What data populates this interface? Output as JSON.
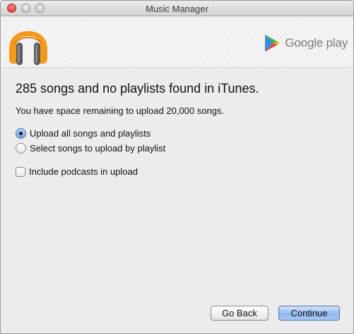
{
  "window": {
    "title": "Music Manager"
  },
  "header": {
    "brand_text": "Google play"
  },
  "content": {
    "heading": "285 songs and no playlists found in iTunes.",
    "subtext": "You have space remaining to upload 20,000 songs.",
    "options": [
      {
        "label": "Upload all songs and playlists",
        "selected": true
      },
      {
        "label": "Select songs to upload by playlist",
        "selected": false
      }
    ],
    "podcasts": {
      "label": "Include podcasts in upload",
      "checked": false
    }
  },
  "buttons": {
    "back": "Go Back",
    "continue": "Continue"
  },
  "colors": {
    "accent": "#6fa1e4",
    "headphone_orange": "#f39a1b",
    "play_green": "#3bb54a",
    "play_blue": "#3c8fd6",
    "play_red": "#e9443a",
    "play_yellow": "#f6c21b"
  }
}
